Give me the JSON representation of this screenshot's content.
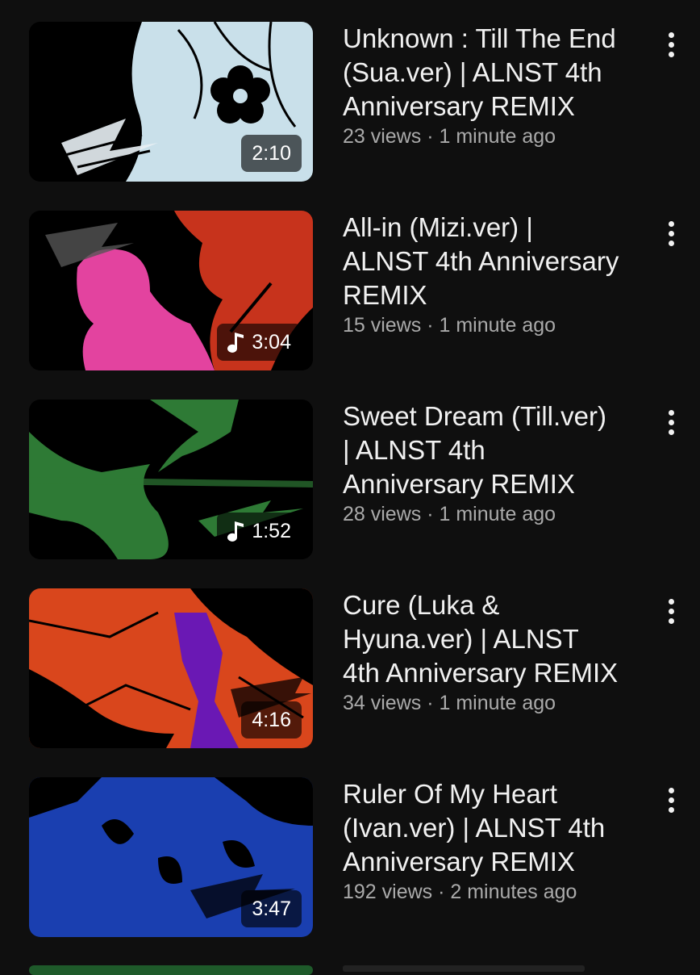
{
  "videos": [
    {
      "title": "Unknown : Till The End\n(Sua.ver)  |  ALNST 4th\nAnniversary REMIX",
      "meta": "23 views · 1 minute ago",
      "duration": "2:10",
      "music_icon": false,
      "thumbnail_colors": [
        "#c9e0ea",
        "#000000"
      ],
      "icons": [
        "flower-icon",
        "alien-stage-logo"
      ]
    },
    {
      "title": "All-in (Mizi.ver)  |\nALNST 4th Anniversary\nREMIX",
      "meta": "15 views · 1 minute ago",
      "duration": "3:04",
      "music_icon": true,
      "thumbnail_colors": [
        "#e3439f",
        "#c7331c",
        "#000000"
      ],
      "icons": [
        "music-note-icon",
        "alien-stage-logo"
      ]
    },
    {
      "title": "Sweet Dream (Till.ver)\n | ALNST 4th\nAnniversary REMIX",
      "meta": "28 views · 1 minute ago",
      "duration": "1:52",
      "music_icon": true,
      "thumbnail_colors": [
        "#2e7a35",
        "#000000"
      ],
      "icons": [
        "music-note-icon",
        "alien-stage-logo"
      ]
    },
    {
      "title": "Cure (Luka &\nHyuna.ver)  |  ALNST\n4th Anniversary REMIX",
      "meta": "34 views · 1 minute ago",
      "duration": "4:16",
      "music_icon": false,
      "thumbnail_colors": [
        "#d9461c",
        "#6a18b4",
        "#000000"
      ],
      "icons": [
        "alien-stage-logo"
      ]
    },
    {
      "title": "Ruler Of My Heart\n(Ivan.ver)  |  ALNST 4th\nAnniversary REMIX",
      "meta": "192 views · 2 minutes ago",
      "duration": "3:47",
      "music_icon": false,
      "thumbnail_colors": [
        "#1a3fb0",
        "#000000"
      ],
      "icons": [
        "alien-stage-logo"
      ]
    }
  ],
  "menu_icon": "more-vertical-icon"
}
